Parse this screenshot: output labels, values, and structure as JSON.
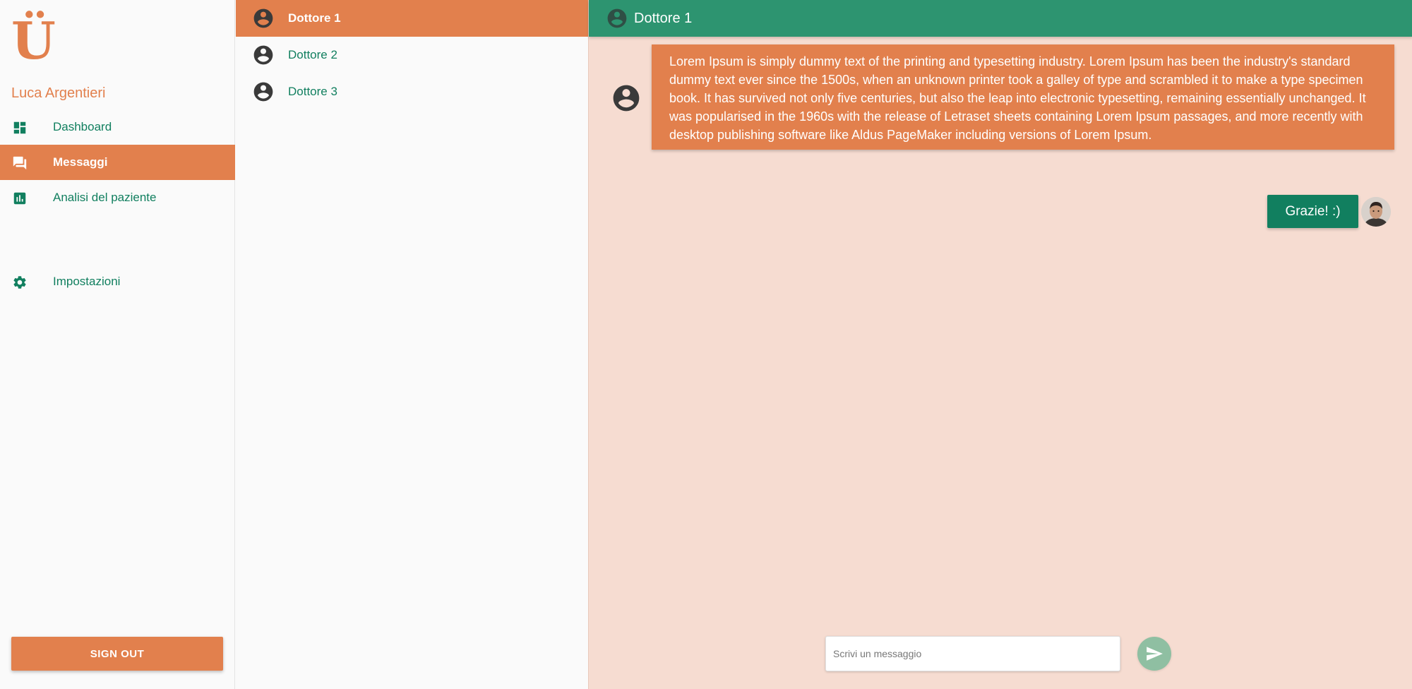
{
  "app": {
    "logo_text": "Ü",
    "accent_color": "#e2804d",
    "primary_color": "#117f5f",
    "header_color": "#2d9470"
  },
  "sidebar": {
    "user_name": "Luca Argentieri",
    "items": [
      {
        "label": "Dashboard",
        "icon": "dashboard-icon",
        "active": false
      },
      {
        "label": "Messaggi",
        "icon": "forum-icon",
        "active": true
      },
      {
        "label": "Analisi del paziente",
        "icon": "bar-chart-icon",
        "active": false
      },
      {
        "label": "Impostazioni",
        "icon": "gear-icon",
        "active": false
      }
    ],
    "signout_label": "SIGN OUT"
  },
  "contacts": [
    {
      "name": "Dottore 1",
      "active": true
    },
    {
      "name": "Dottore 2",
      "active": false
    },
    {
      "name": "Dottore 3",
      "active": false
    }
  ],
  "chat": {
    "header_name": "Dottore 1",
    "messages": [
      {
        "from": "Dottore 1",
        "text": "Lorem Ipsum is simply dummy text of the printing and typesetting industry. Lorem Ipsum has been the industry's standard dummy text ever since the 1500s, when an unknown printer took a galley of type and scrambled it to make a type specimen book. It has survived not only five centuries, but also the leap into electronic typesetting, remaining essentially unchanged. It was popularised in the 1960s with the release of Letraset sheets containing Lorem Ipsum passages, and more recently with desktop publishing software like Aldus PageMaker including versions of Lorem Ipsum."
      },
      {
        "from": "me",
        "text": "Grazie! :)"
      }
    ],
    "composer": {
      "placeholder": "Scrivi un messaggio",
      "value": ""
    }
  }
}
